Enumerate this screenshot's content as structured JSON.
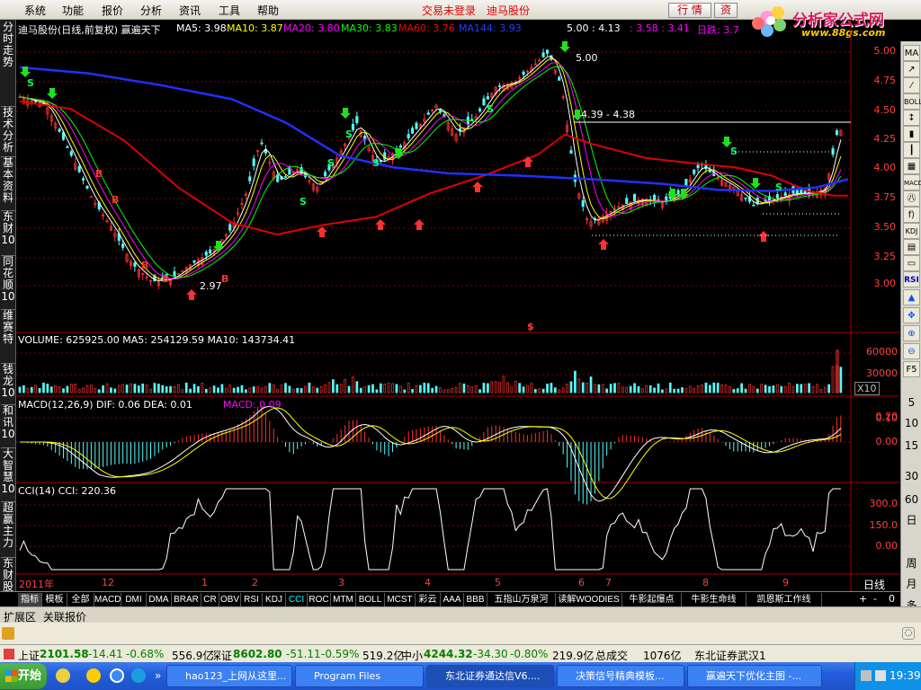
{
  "menubar": {
    "items": [
      "系统",
      "功能",
      "报价",
      "分析",
      "资讯",
      "工具",
      "帮助"
    ],
    "alerts": [
      "交易未登录",
      "迪马股份"
    ],
    "buttons": [
      "行 情",
      "资"
    ]
  },
  "logo": {
    "text": "分析家公式网",
    "url": "www.88gs.com"
  },
  "left_tabs": [
    "分时走势",
    "技术分析",
    "基本资料",
    "东财10",
    "同花顺10",
    "维赛特",
    "钱龙10",
    "和讯10",
    "大智慧10",
    "超赢主力",
    "东财股吧"
  ],
  "right_tools": [
    "MA",
    "BOLL",
    "MACD",
    "KDJ",
    "RSI",
    "F5"
  ],
  "right_numbers": [
    "30",
    "60",
    "日",
    "周",
    "月",
    "多"
  ],
  "main_panel": {
    "title": "迪马股份(日线,前复权) 赢遍天下",
    "ma": [
      {
        "label": "MA5: 3.98",
        "color": "#ffffff"
      },
      {
        "label": "MA10: 3.87",
        "color": "#ffff00"
      },
      {
        "label": "MA20: 3.80",
        "color": "#ff00ff"
      },
      {
        "label": "MA30: 3.83",
        "color": "#00ff00"
      },
      {
        "label": "MA60: 3.76",
        "color": "#ff0000"
      },
      {
        "label": "MA144: 3.93",
        "color": "#2040ff"
      }
    ],
    "extra1": "5.00 : 4.13",
    "extra2": ": 3.58 : 3.41",
    "daily": "日跌: 3.7",
    "yaxis": [
      "5.00",
      "4.75",
      "4.50",
      "4.25",
      "4.00",
      "3.75",
      "3.50",
      "3.25",
      "3.00"
    ],
    "annotations": [
      "5.00",
      "4.39 - 4.38",
      "2.97"
    ],
    "marker_s": "$"
  },
  "volume_panel": {
    "label": "VOLUME: 625925.00  MA5: 254129.59  MA10: 143734.41",
    "yaxis": [
      "60000",
      "30000"
    ],
    "unit": "X10"
  },
  "macd_panel": {
    "label_prefix": "MACD(12,26,9)  DIF: 0.06  DEA: 0.01",
    "label_macd": "MACD: 0.09",
    "yaxis": [
      "0.20",
      "0.10",
      "0.00"
    ]
  },
  "cci_panel": {
    "label": "CCI(14)  CCI: 220.36",
    "yaxis": [
      "300.0",
      "150.0",
      "0.00"
    ]
  },
  "xaxis": {
    "labels": [
      "2011年",
      "12",
      "1",
      "2",
      "3",
      "4",
      "5",
      "6",
      "7",
      "8",
      "9",
      "10"
    ],
    "period": "日线"
  },
  "index_tabs": [
    "指标",
    "模板",
    "全部",
    "MACD",
    "DMI",
    "DMA",
    "BRAR",
    "CR",
    "OBV",
    "RSI",
    "KDJ",
    "CCI",
    "ROC",
    "MTM",
    "BOLL",
    "MCST",
    "彩云",
    "AAA",
    "BBB",
    "五指山万泉河",
    "读解WOODIES",
    "牛影起爆点",
    "牛影生命线",
    "凯恩斯工作线"
  ],
  "index_controls": [
    "+",
    "-",
    "0"
  ],
  "exp_tabs": [
    "扩展区",
    "关联报价"
  ],
  "status": {
    "sh_name": "上证",
    "sh_val": "2101.58",
    "sh_chg": "-14.41",
    "sh_pct": "-0.68%",
    "sh_amt": "556.9亿",
    "sz_name": "深证",
    "sz_val": "8602.80",
    "sz_chg": "-51.11",
    "sz_pct": "-0.59%",
    "sz_amt": "519.2亿",
    "zx_name": "中小",
    "zx_val": "4244.32",
    "zx_chg": "-34.30",
    "zx_pct": "-0.80%",
    "zx_amt": "219.9亿",
    "total_label": "总成交",
    "total_val": "1076亿",
    "broker": "东北证券武汉1"
  },
  "taskbar": {
    "start": "开始",
    "tasks": [
      "hao123_上网从这里...",
      "Program Files",
      "东北证券通达信V6....",
      "决策信号精典模板...",
      "赢遍天下优化主图 -..."
    ],
    "clock": "19:39"
  }
}
